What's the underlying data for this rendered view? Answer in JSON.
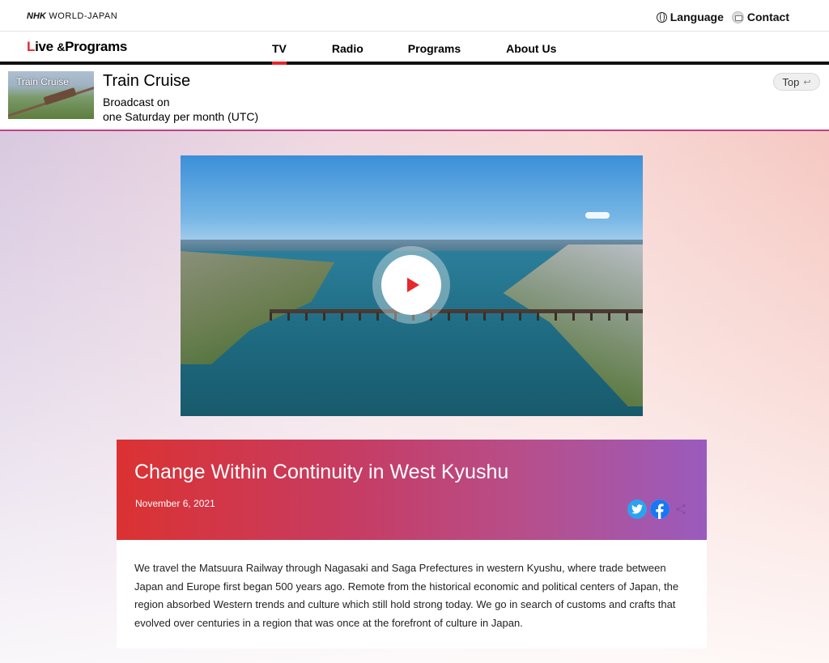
{
  "header": {
    "logo": {
      "brand": "NHK",
      "suffix": "WORLD-JAPAN"
    },
    "links": [
      {
        "label": "Language",
        "icon": "globe-icon"
      },
      {
        "label": "Contact",
        "icon": "mail-icon"
      }
    ]
  },
  "nav": {
    "brand_first_letter": "L",
    "brand_rest": "ive",
    "brand_amp": "&",
    "brand_tail": "Programs",
    "items": [
      {
        "label": "TV",
        "active": true
      },
      {
        "label": "Radio",
        "active": false
      },
      {
        "label": "Programs",
        "active": false
      },
      {
        "label": "About Us",
        "active": false
      }
    ]
  },
  "program": {
    "thumb_title": "Train Cruise",
    "title": "Train Cruise",
    "broadcast_line1": "Broadcast on",
    "broadcast_line2": "one Saturday per month (UTC)",
    "top_button": "Top"
  },
  "video": {
    "play_icon": "play-icon"
  },
  "episode": {
    "title": "Change Within Continuity in West Kyushu",
    "date": "November 6, 2021",
    "share": [
      "twitter-icon",
      "facebook-icon",
      "share-icon"
    ],
    "description": "We travel the Matsuura Railway through Nagasaki and Saga Prefectures in western Kyushu, where trade between Japan and Europe first began 500 years ago. Remote from the historical economic and political centers of Japan, the region absorbed Western trends and culture which still hold strong today. We go in search of customs and crafts that evolved over centuries in a region that was once at the forefront of culture in Japan."
  },
  "colors": {
    "accent_red": "#e8282b",
    "twitter_blue": "#2aa3ef",
    "header_gradient_start": "#db3232",
    "header_gradient_end": "#9a5bbd"
  }
}
